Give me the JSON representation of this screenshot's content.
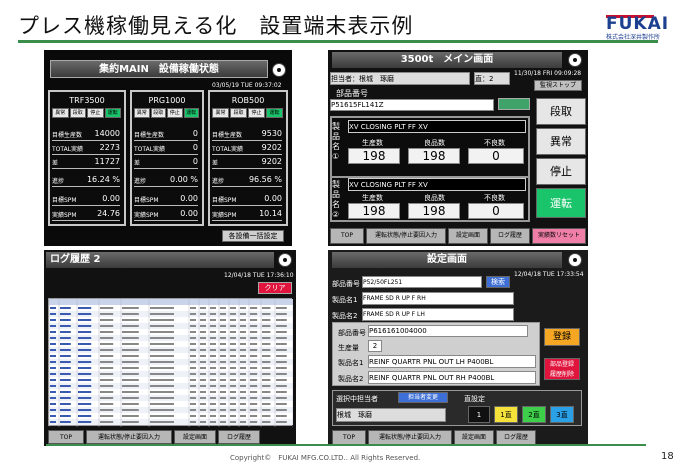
{
  "slide": {
    "title": "プレス機稼働見える化　設置端末表示例",
    "logo": "FUKAI",
    "logo_sub": "株式会社深井製作所",
    "footer": "Copyright©　FUKAI MFG.CO.LTD.. All Rights Reserved.",
    "page": "18"
  },
  "s1": {
    "title": "集約MAIN　設備稼働状態",
    "datetime": "03/05/19 TUE 09:37:02",
    "button": "各設備一括設定",
    "machines": [
      {
        "name": "TRF3500",
        "s": [
          "異常",
          "段取",
          "停止",
          "運転"
        ],
        "r": [
          [
            "目標生産数",
            "14000"
          ],
          [
            "TOTAL実績",
            "2273"
          ],
          [
            "差",
            "11727"
          ],
          [
            "進捗",
            "16.24 %"
          ],
          [
            "目標SPM",
            "0.00"
          ],
          [
            "実績SPM",
            "24.76"
          ]
        ]
      },
      {
        "name": "PRG1000",
        "s": [
          "異常",
          "段取",
          "停止",
          "運転"
        ],
        "r": [
          [
            "目標生産数",
            "0"
          ],
          [
            "TOTAL実績",
            "0"
          ],
          [
            "差",
            "0"
          ],
          [
            "進捗",
            "0.00 %"
          ],
          [
            "目標SPM",
            "0.00"
          ],
          [
            "実績SPM",
            "0.00"
          ]
        ]
      },
      {
        "name": "ROB500",
        "s": [
          "異常",
          "段取",
          "停止",
          "運転"
        ],
        "r": [
          [
            "目標生産数",
            "9530"
          ],
          [
            "TOTAL実績",
            "9202"
          ],
          [
            "差",
            "9202"
          ],
          [
            "進捗",
            "96.56 %"
          ],
          [
            "目標SPM",
            "0.00"
          ],
          [
            "実績SPM",
            "10.14"
          ]
        ]
      }
    ]
  },
  "s2": {
    "title": "3500t　メイン画面",
    "op_label": "担当者：",
    "op": "根城　琢磨",
    "dir_label": "直：",
    "dir": "2",
    "datetime": "11/30/18 FRI 09:09:28",
    "monitor": "監視ストップ",
    "part_label": "部品番号",
    "part": "P51615FL141Z",
    "name_label": "製品名",
    "p1": {
      "num": "①",
      "name": "XV CLOSING PLT FF XV",
      "h": [
        "生産数",
        "良品数",
        "不良数"
      ],
      "v": [
        "198",
        "198",
        "0"
      ]
    },
    "p2": {
      "num": "②",
      "name": "XV CLOSING PLT FF XV",
      "h": [
        "生産数",
        "良品数",
        "不良数"
      ],
      "v": [
        "198",
        "198",
        "0"
      ]
    },
    "side": [
      "段取",
      "異常",
      "停止",
      "運転"
    ],
    "tabs": [
      "TOP",
      "運転状態/停止要因入力",
      "設定画面",
      "ログ履歴",
      "実績数リセット"
    ]
  },
  "s3": {
    "title": "ログ履歴 2",
    "datetime": "12/04/18 TUE 17:36:10",
    "clear": "クリア",
    "tabs": [
      "TOP",
      "運転状態/停止要因入力",
      "設定画面",
      "ログ履歴"
    ]
  },
  "s4": {
    "title": "設定画面",
    "datetime": "12/04/18 TUE 17:33:54",
    "l1": "部品番号",
    "v1": "P52/50FL251",
    "search": "検索",
    "l2": "製品名1",
    "v2": "FRAME SD R UP F RH",
    "l3": "製品名2",
    "v3": "FRAME SD R UP F LH",
    "l4": "部品番号",
    "v4": "P616161004000",
    "reg": "登録",
    "l5": "生産量",
    "v5": "2",
    "l6": "製品名1",
    "v6": "REINF QUARTR PNL OUT LH P400BL",
    "l7": "製品名2",
    "v7": "REINF QUARTR PNL OUT RH P400BL",
    "del": "部品登録\n履歴削除",
    "sel": "選択中担当者",
    "change": "担当者変更",
    "shift": "直設定",
    "worker": "根城　琢磨",
    "d": [
      "1",
      "1直",
      "2直",
      "3直"
    ],
    "tabs": [
      "TOP",
      "運転状態/停止要因入力",
      "設定画面",
      "ログ履歴"
    ]
  }
}
